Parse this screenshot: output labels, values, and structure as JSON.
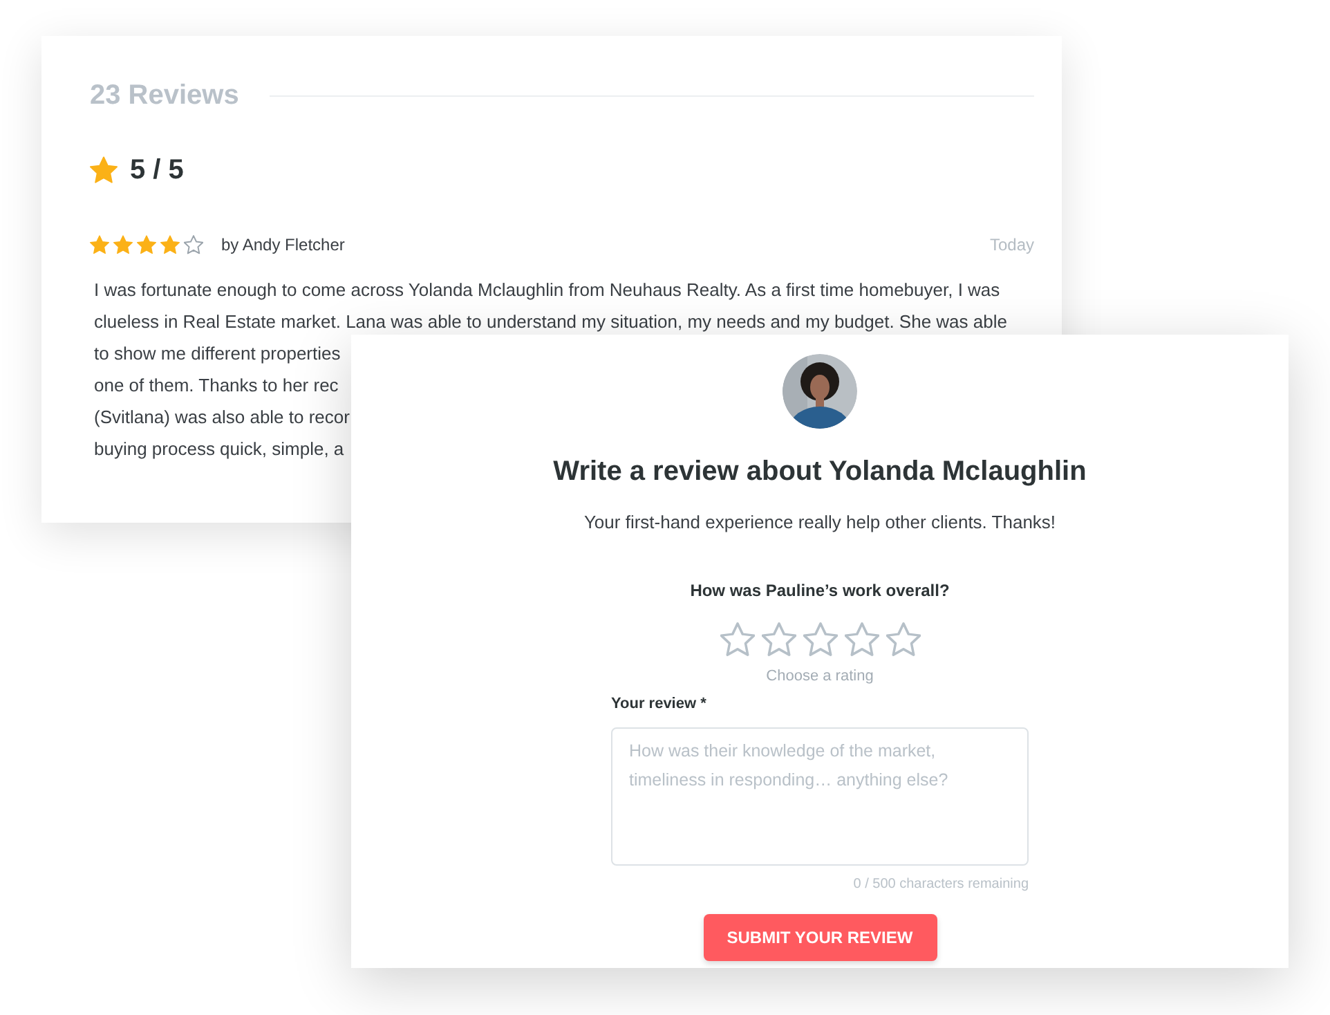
{
  "reviews_panel": {
    "title": "23 Reviews",
    "average_score": "5 / 5",
    "review": {
      "stars": 4,
      "author": "by Andy Fletcher",
      "date": "Today",
      "text_lines": [
        "I was fortunate enough to come across Yolanda Mclaughlin from Neuhaus Realty. As a first time homebuyer, I was",
        "clueless in Real Estate market. Lana was able to understand my situation, my needs and my budget. She was able",
        "to show me different properties",
        "one of them. Thanks to her rec",
        "(Svitlana) was also able to recor",
        "buying process quick, simple, a"
      ]
    }
  },
  "review_form": {
    "title": "Write a review about Yolanda Mclaughlin",
    "subtitle": "Your first-hand experience really help other clients. Thanks!",
    "question": "How was Pauline’s work overall?",
    "rating": {
      "stars": 0,
      "hint": "Choose a rating"
    },
    "review_field": {
      "label": "Your review *",
      "placeholder": "How was their knowledge of the market, timeliness in responding… anything else?",
      "counter": "0 / 500 characters remaining"
    },
    "submit_button": "SUBMIT YOUR REVIEW"
  }
}
